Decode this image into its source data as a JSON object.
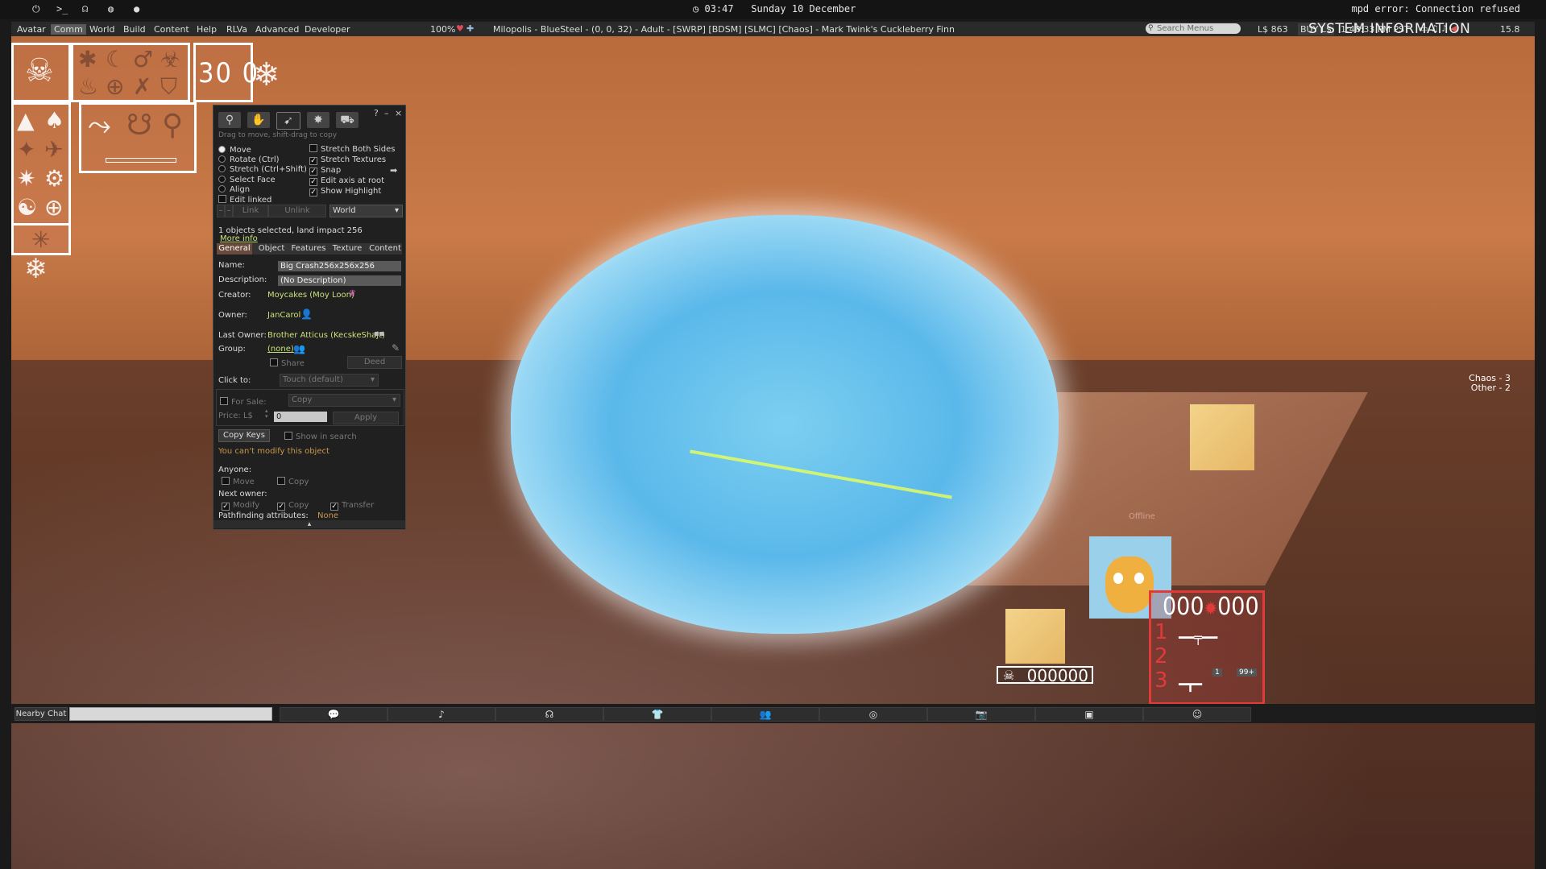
{
  "system_bar": {
    "icons": [
      "power-icon",
      "terminal-icon",
      "headset-icon",
      "gamepad-icon",
      "chat-bubble-icon"
    ],
    "clock_icon": "clock-icon",
    "time": "03:47",
    "date": "Sunday 10 December",
    "error": "mpd error: Connection refused"
  },
  "menubar": {
    "items": [
      "Avatar",
      "Comm",
      "World",
      "Build",
      "Content",
      "Help",
      "RLVa",
      "Advanced",
      "Developer"
    ],
    "active": "Comm",
    "zoom": "100%",
    "region": "Milopolis - BlueSteel - (0, 0, 32) - Adult - [SWRP] [BDSM] [SLMC] [Chaos] - Mark Twink's Cuckleberry Finn",
    "search_placeholder": "Search Menus",
    "balance": "L$ 863",
    "buy_label": "BUY L$",
    "time": "1:48:33 PM PST",
    "fps": "15.8",
    "system_information": "SYSTEM INFORMATION"
  },
  "hud_left": {
    "timer": "30 0"
  },
  "build": {
    "help": "?",
    "minimize": "–",
    "close": "×",
    "hint": "Drag to move, shift-drag to copy",
    "modes": [
      {
        "label": "Move",
        "on": true
      },
      {
        "label": "Rotate (Ctrl)",
        "on": false
      },
      {
        "label": "Stretch (Ctrl+Shift)",
        "on": false
      },
      {
        "label": "Select Face",
        "on": false
      },
      {
        "label": "Align",
        "on": false
      }
    ],
    "edit_linked": "Edit linked",
    "options": [
      {
        "label": "Stretch Both Sides",
        "on": false
      },
      {
        "label": "Stretch Textures",
        "on": true
      },
      {
        "label": "Snap",
        "on": true
      },
      {
        "label": "Edit axis at root",
        "on": true
      },
      {
        "label": "Show Highlight",
        "on": true
      }
    ],
    "link": "Link",
    "unlink": "Unlink",
    "ruler": "World",
    "selection": "1 objects selected, land impact 256",
    "more_info": "More info",
    "tabs": [
      "General",
      "Object",
      "Features",
      "Texture",
      "Content"
    ],
    "general": {
      "name_label": "Name:",
      "name": "Big Crash256x256x256",
      "description_label": "Description:",
      "description": "(No Description)",
      "creator_label": "Creator:",
      "creator": "Moycakes (Moy Loon)",
      "owner_label": "Owner:",
      "owner": "JanCarol",
      "last_owner_label": "Last Owner:",
      "last_owner": "Brother Atticus (KecskeShajt)",
      "group_label": "Group:",
      "group": "(none)",
      "share": "Share",
      "deed": "Deed",
      "click_to_label": "Click to:",
      "click_to": "Touch  (default)",
      "for_sale": "For Sale:",
      "sale_type": "Copy",
      "price_label": "Price: L$",
      "price": "0",
      "apply": "Apply",
      "copy_keys": "Copy Keys",
      "show_in_search": "Show in search",
      "cannot_modify": "You can't modify this object",
      "anyone_label": "Anyone:",
      "anyone_move": "Move",
      "anyone_copy": "Copy",
      "next_owner_label": "Next owner:",
      "next_modify": "Modify",
      "next_copy": "Copy",
      "next_transfer": "Transfer",
      "pathfinding_label": "Pathfinding attributes:",
      "pathfinding": "None"
    }
  },
  "world": {
    "chaos": "Chaos - 3",
    "other": "Other - 2",
    "offline": "Offline",
    "score": "000000",
    "ammo_left": "000",
    "ammo_right": "000",
    "slots": [
      "1",
      "2",
      "3"
    ],
    "counter_a": "1",
    "counter_b": "99+"
  },
  "bottom_bar": {
    "nearby_chat": "Nearby Chat",
    "buttons": [
      "chat-icon",
      "microphone-icon",
      "headphones-icon",
      "shirt-icon",
      "people-icon",
      "radar-icon",
      "camera-icon",
      "inventory-icon",
      "avatar-icon"
    ]
  },
  "colors": {
    "accent": "#6a4a3a",
    "link": "#c8e07a",
    "warning": "#c8964a",
    "hud_red": "#e03a3a"
  }
}
